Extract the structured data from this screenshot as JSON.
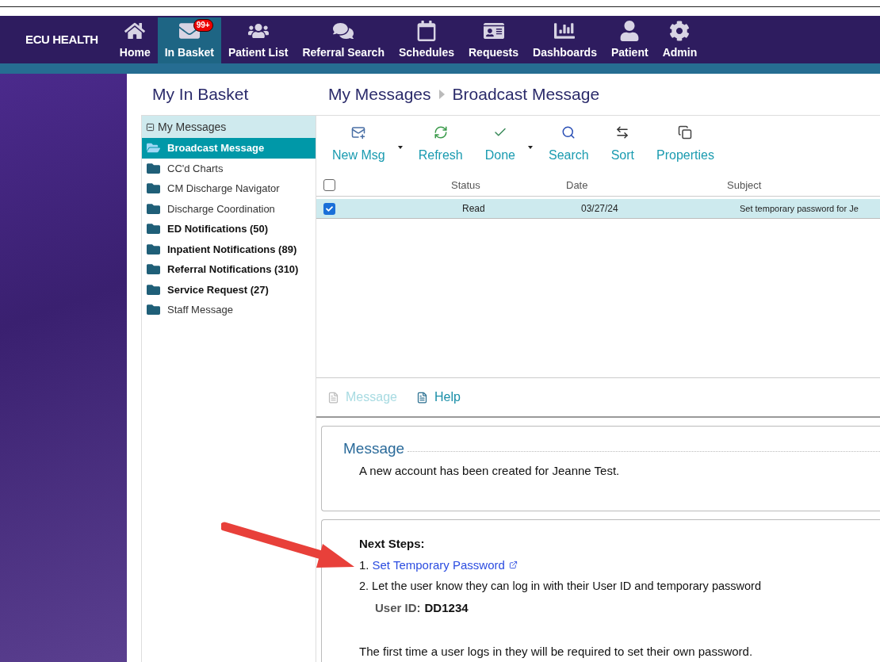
{
  "brand": {
    "name": "ECU HEALTH"
  },
  "nav": [
    {
      "label": "Home",
      "selected": false
    },
    {
      "label": "In Basket",
      "selected": true,
      "badge": "99+"
    },
    {
      "label": "Patient List",
      "selected": false
    },
    {
      "label": "Referral Search",
      "selected": false
    },
    {
      "label": "Schedules",
      "selected": false
    },
    {
      "label": "Requests",
      "selected": false
    },
    {
      "label": "Dashboards",
      "selected": false
    },
    {
      "label": "Patient",
      "selected": false
    },
    {
      "label": "Admin",
      "selected": false
    }
  ],
  "sidebar": {
    "title": "My In Basket",
    "group": {
      "label": "My Messages",
      "expanded": true
    },
    "items": [
      {
        "label": "Broadcast Message",
        "selected": true,
        "unread": false
      },
      {
        "label": "CC'd Charts",
        "selected": false,
        "unread": false
      },
      {
        "label": "CM Discharge Navigator",
        "selected": false,
        "unread": false
      },
      {
        "label": "Discharge Coordination",
        "selected": false,
        "unread": false
      },
      {
        "label": "ED Notifications (50)",
        "selected": false,
        "unread": true
      },
      {
        "label": "Inpatient Notifications (89)",
        "selected": false,
        "unread": true
      },
      {
        "label": "Referral Notifications (310)",
        "selected": false,
        "unread": true
      },
      {
        "label": "Service Request (27)",
        "selected": false,
        "unread": true
      },
      {
        "label": "Staff Message",
        "selected": false,
        "unread": false
      }
    ]
  },
  "breadcrumb": [
    "My Messages",
    "Broadcast Message"
  ],
  "toolbar": [
    {
      "label": "New Msg",
      "dropdown": true
    },
    {
      "label": "Refresh",
      "dropdown": false
    },
    {
      "label": "Done",
      "dropdown": true
    },
    {
      "label": "Search",
      "dropdown": false
    },
    {
      "label": "Sort",
      "dropdown": false
    },
    {
      "label": "Properties",
      "dropdown": false
    }
  ],
  "table": {
    "all_checked": false,
    "columns": [
      "Status",
      "Date",
      "Subject"
    ],
    "rows": [
      {
        "checked": true,
        "selected": true,
        "cells": [
          "Read",
          "03/27/24",
          "Set temporary password for Je"
        ]
      }
    ]
  },
  "bottom_toolbar": [
    {
      "label": "Message",
      "disabled": true
    },
    {
      "label": "Help",
      "disabled": false
    }
  ],
  "message": {
    "heading": "Message",
    "text": "A new account has been created for Jeanne Test."
  },
  "next_steps": {
    "heading": "Next Steps:",
    "link_prefix": "1. ",
    "link": "Set Temporary Password",
    "step_2": "2. Let the user know they can log in with their User ID and temporary password",
    "user_id_label": "User ID:",
    "user_id": "DD1234",
    "footer": "The first time a user logs in they will be required to set their own password."
  }
}
